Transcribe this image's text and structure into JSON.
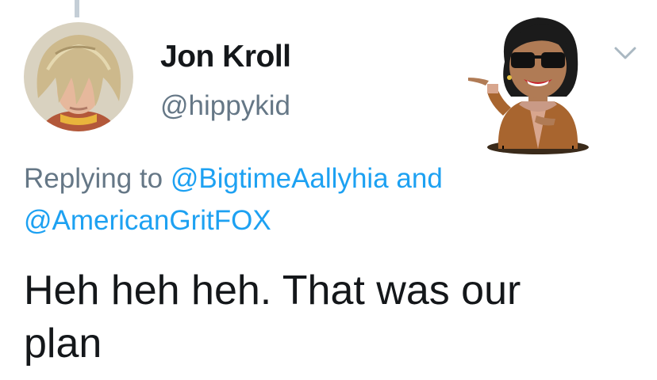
{
  "tweet": {
    "author": {
      "display_name": "Jon Kroll",
      "handle": "@hippykid",
      "avatar_icon": "avatar-photo"
    },
    "reply": {
      "prefix": "Replying to",
      "mention_1": "@BigtimeAallyhia",
      "conjunction": "and",
      "mention_2": "@AmericanGritFOX"
    },
    "text_line_1": "Heh heh heh. That was our",
    "text_line_2": "plan",
    "menu_icon": "chevron-down-icon",
    "sticker_icon": "bitmoji-sticker"
  },
  "colors": {
    "link": "#1da1f2",
    "secondary_text": "#657786",
    "primary_text": "#14171a",
    "thread_line": "#c4ced6"
  }
}
